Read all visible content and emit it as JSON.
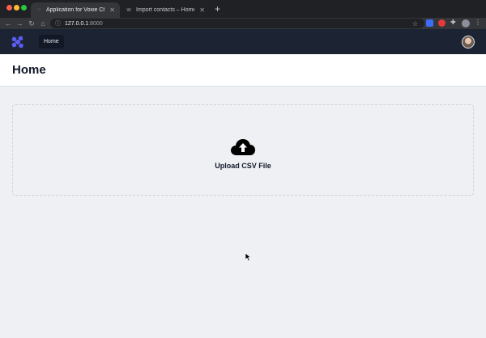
{
  "browser": {
    "tabs": [
      {
        "title": "Application for Voxie Chat",
        "active": true,
        "favicon": "loading-icon"
      },
      {
        "title": "Import contacts – Home",
        "active": false,
        "favicon": "w-favicon"
      }
    ],
    "new_tab_label": "+",
    "address": {
      "host": "127.0.0.1",
      "port": ":8000"
    }
  },
  "app": {
    "nav": {
      "home_label": "Home"
    },
    "brand_color": "#5b5ef5"
  },
  "page": {
    "title": "Home",
    "upload_label": "Upload CSV File"
  }
}
